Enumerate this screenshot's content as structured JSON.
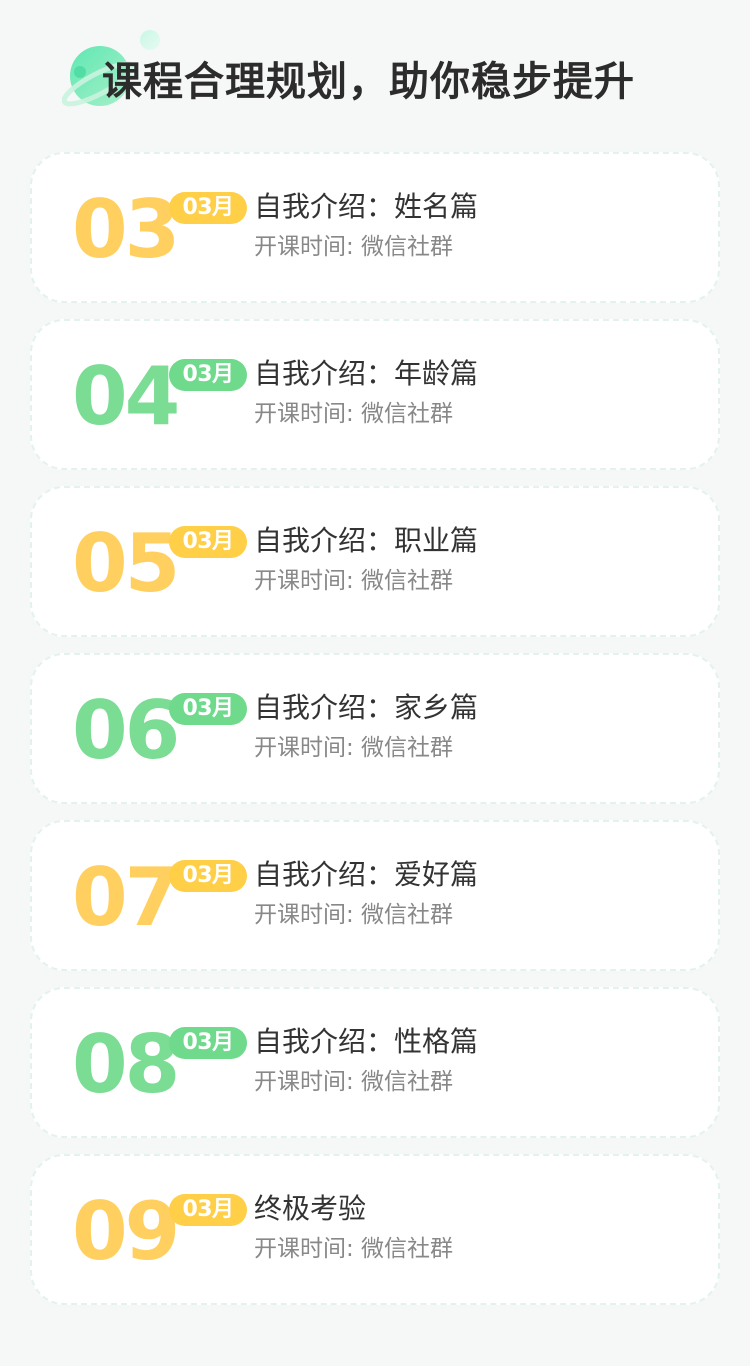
{
  "header": {
    "title": "课程合理规划，助你稳步提升",
    "logo_icon": "planet-icon"
  },
  "colors": {
    "yellow_number": "#ffd060",
    "green_number": "#7bdc94",
    "yellow_badge": "#ffcf48",
    "green_badge": "#6fd98c"
  },
  "courses": [
    {
      "day": "03",
      "month": "03月",
      "title": "自我介绍：姓名篇",
      "time": "开课时间: 微信社群",
      "accent": "yellow"
    },
    {
      "day": "04",
      "month": "03月",
      "title": "自我介绍：年龄篇",
      "time": "开课时间: 微信社群",
      "accent": "green"
    },
    {
      "day": "05",
      "month": "03月",
      "title": "自我介绍：职业篇",
      "time": "开课时间: 微信社群",
      "accent": "yellow"
    },
    {
      "day": "06",
      "month": "03月",
      "title": "自我介绍：家乡篇",
      "time": "开课时间: 微信社群",
      "accent": "green"
    },
    {
      "day": "07",
      "month": "03月",
      "title": "自我介绍：爱好篇",
      "time": "开课时间: 微信社群",
      "accent": "yellow"
    },
    {
      "day": "08",
      "month": "03月",
      "title": "自我介绍：性格篇",
      "time": "开课时间: 微信社群",
      "accent": "green"
    },
    {
      "day": "09",
      "month": "03月",
      "title": "终极考验",
      "time": "开课时间: 微信社群",
      "accent": "yellow"
    }
  ]
}
